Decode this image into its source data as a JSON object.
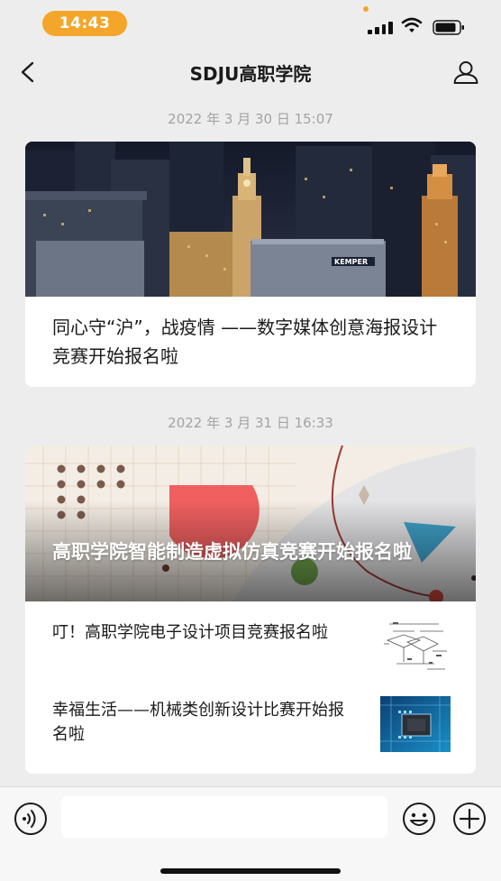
{
  "status_bar": {
    "time": "14:43"
  },
  "nav": {
    "title": "SDJU高职学院"
  },
  "messages": [
    {
      "timestamp": "2022 年 3 月 30 日 15:07",
      "card": {
        "title": "同心守“沪”，战疫情 ——数字媒体创意海报设计竞赛开始报名啦",
        "cover_sign_text": "KEMPER"
      }
    },
    {
      "timestamp": "2022 年 3 月 31 日 16:33",
      "card": {
        "title": "高职学院智能制造虚拟仿真竞赛开始报名啦",
        "sub_articles": [
          {
            "title": "叮！高职学院电子设计项目竞赛报名啦",
            "thumb_icon": "circuit-diagram-icon"
          },
          {
            "title": "幸福生活——机械类创新设计比赛开始报名啦",
            "thumb_icon": "chip-board-icon"
          }
        ]
      }
    }
  ],
  "input_bar": {
    "value": "",
    "voice_icon": "voice-icon",
    "emoji_icon": "emoji-icon",
    "plus_icon": "plus-icon"
  },
  "colors": {
    "background": "#ededed",
    "time_pill": "#f4a62a",
    "timestamp_text": "#a3a3a3"
  }
}
